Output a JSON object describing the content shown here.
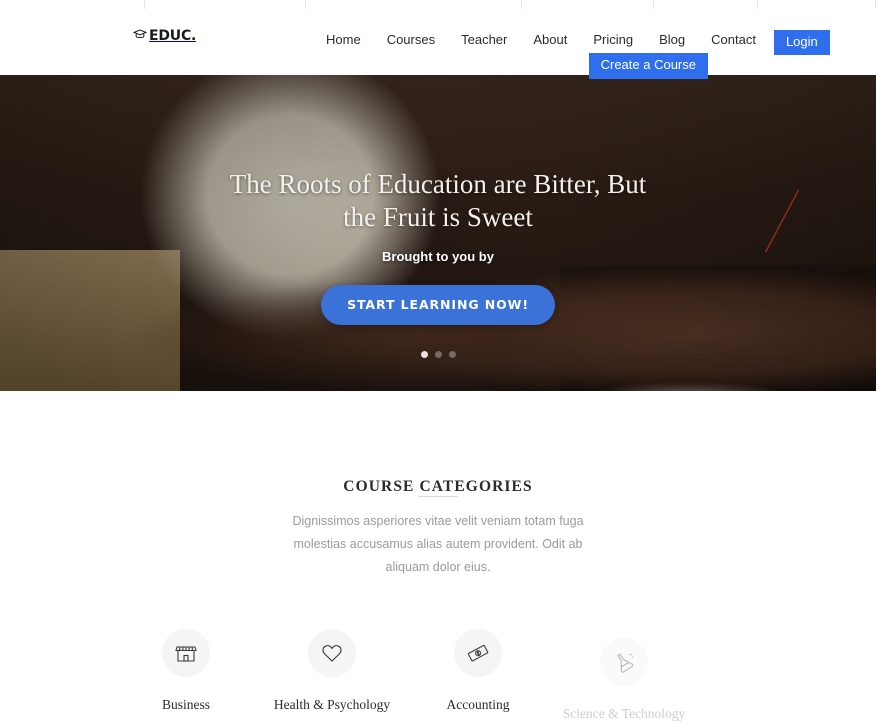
{
  "browser": {
    "tab_widths": [
      240,
      268,
      358,
      220,
      172,
      196
    ]
  },
  "header": {
    "logo": {
      "icon": "graduation-cap-icon",
      "text": "EDUC."
    },
    "nav_links": [
      {
        "label": "Home"
      },
      {
        "label": "Courses"
      },
      {
        "label": "Teacher"
      },
      {
        "label": "About"
      },
      {
        "label": "Pricing"
      },
      {
        "label": "Blog"
      },
      {
        "label": "Contact"
      }
    ],
    "login_label": "Login",
    "create_course_label": "Create a Course",
    "accent_color": "#2f6fed"
  },
  "hero": {
    "title": "The Roots of Education are Bitter, But the Fruit is Sweet",
    "subtitle": "Brought to you by",
    "cta_label": "START LEARNING NOW!",
    "cta_color": "#3a72d8",
    "slides": [
      {
        "active": true
      },
      {
        "active": false
      },
      {
        "active": false
      }
    ]
  },
  "categories": {
    "heading": "COURSE CATEGORIES",
    "description": "Dignissimos asperiores vitae velit veniam totam fuga molestias accusamus alias autem provident. Odit ab aliquam dolor eius.",
    "items": [
      {
        "label": "Business",
        "icon": "shop-icon",
        "pending": false
      },
      {
        "label": "Health & Psychology",
        "icon": "heart-icon",
        "pending": false
      },
      {
        "label": "Accounting",
        "icon": "banknote-icon",
        "pending": false
      },
      {
        "label": "Science & Technology",
        "icon": "flask-icon",
        "pending": true
      }
    ]
  }
}
